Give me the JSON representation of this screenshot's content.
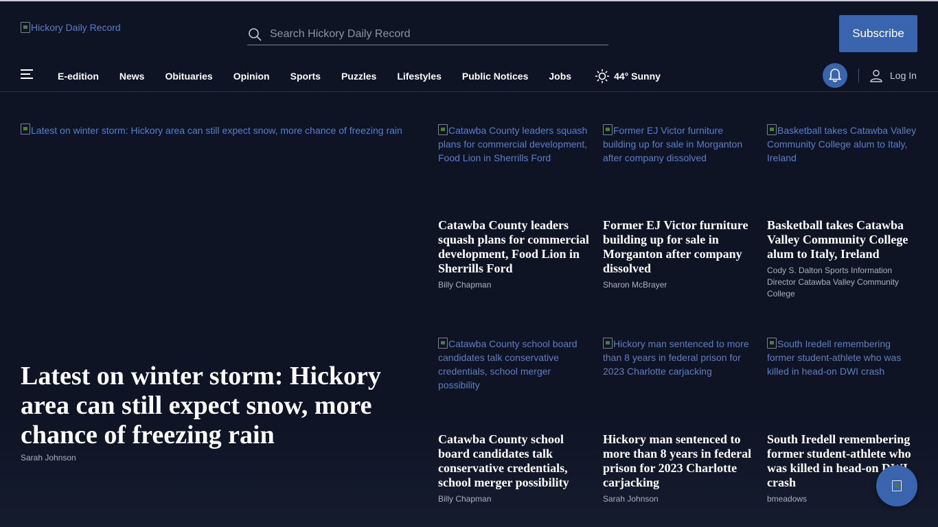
{
  "header": {
    "logo_alt": "Hickory Daily Record",
    "search_placeholder": "Search Hickory Daily Record",
    "subscribe_label": "Subscribe"
  },
  "nav": {
    "items": [
      "E-edition",
      "News",
      "Obituaries",
      "Opinion",
      "Sports",
      "Puzzles",
      "Lifestyles",
      "Public Notices",
      "Jobs"
    ],
    "weather": "44° Sunny",
    "login_label": "Log In"
  },
  "lead": {
    "image_alt": "Latest on winter storm: Hickory area can still expect snow, more chance of freezing rain",
    "title": "Latest on winter storm: Hickory area can still expect snow, more chance of freezing rain",
    "author": "Sarah Johnson"
  },
  "cards": [
    {
      "image_alt": "Catawba County leaders squash plans for commercial development, Food Lion in Sherrills Ford",
      "title": "Catawba County leaders squash plans for commercial development, Food Lion in Sherrills Ford",
      "author": "Billy Chapman"
    },
    {
      "image_alt": "Former EJ Victor furniture building up for sale in Morganton after company dissolved",
      "title": "Former EJ Victor furniture building up for sale in Morganton after company dissolved",
      "author": "Sharon McBrayer"
    },
    {
      "image_alt": "Basketball takes Catawba Valley Community College alum to Italy, Ireland",
      "title": "Basketball takes Catawba Valley Community College alum to Italy, Ireland",
      "author": "Cody S. Dalton Sports Information Director Catawba Valley Community College"
    },
    {
      "image_alt": "Catawba County school board candidates talk conservative credentials, school merger possibility",
      "title": "Catawba County school board candidates talk conservative credentials, school merger possibility",
      "author": "Billy Chapman"
    },
    {
      "image_alt": "Hickory man sentenced to more than 8 years in federal prison for 2023 Charlotte carjacking",
      "title": "Hickory man sentenced to more than 8 years in federal prison for 2023 Charlotte carjacking",
      "author": "Sarah Johnson"
    },
    {
      "image_alt": "South Iredell remembering former student-athlete who was killed in head-on DWI crash",
      "title": "South Iredell remembering former student-athlete who was killed in head-on DWI crash",
      "author": "bmeadows"
    }
  ],
  "colors": {
    "background": "#0e1424",
    "accent": "#3a64ad",
    "link": "#5b7ec8"
  },
  "icons": {
    "search": "search-icon",
    "menu": "hamburger-menu-icon",
    "weather": "sun-icon",
    "notifications": "bell-icon",
    "account": "user-icon",
    "chat": "chat-icon"
  }
}
